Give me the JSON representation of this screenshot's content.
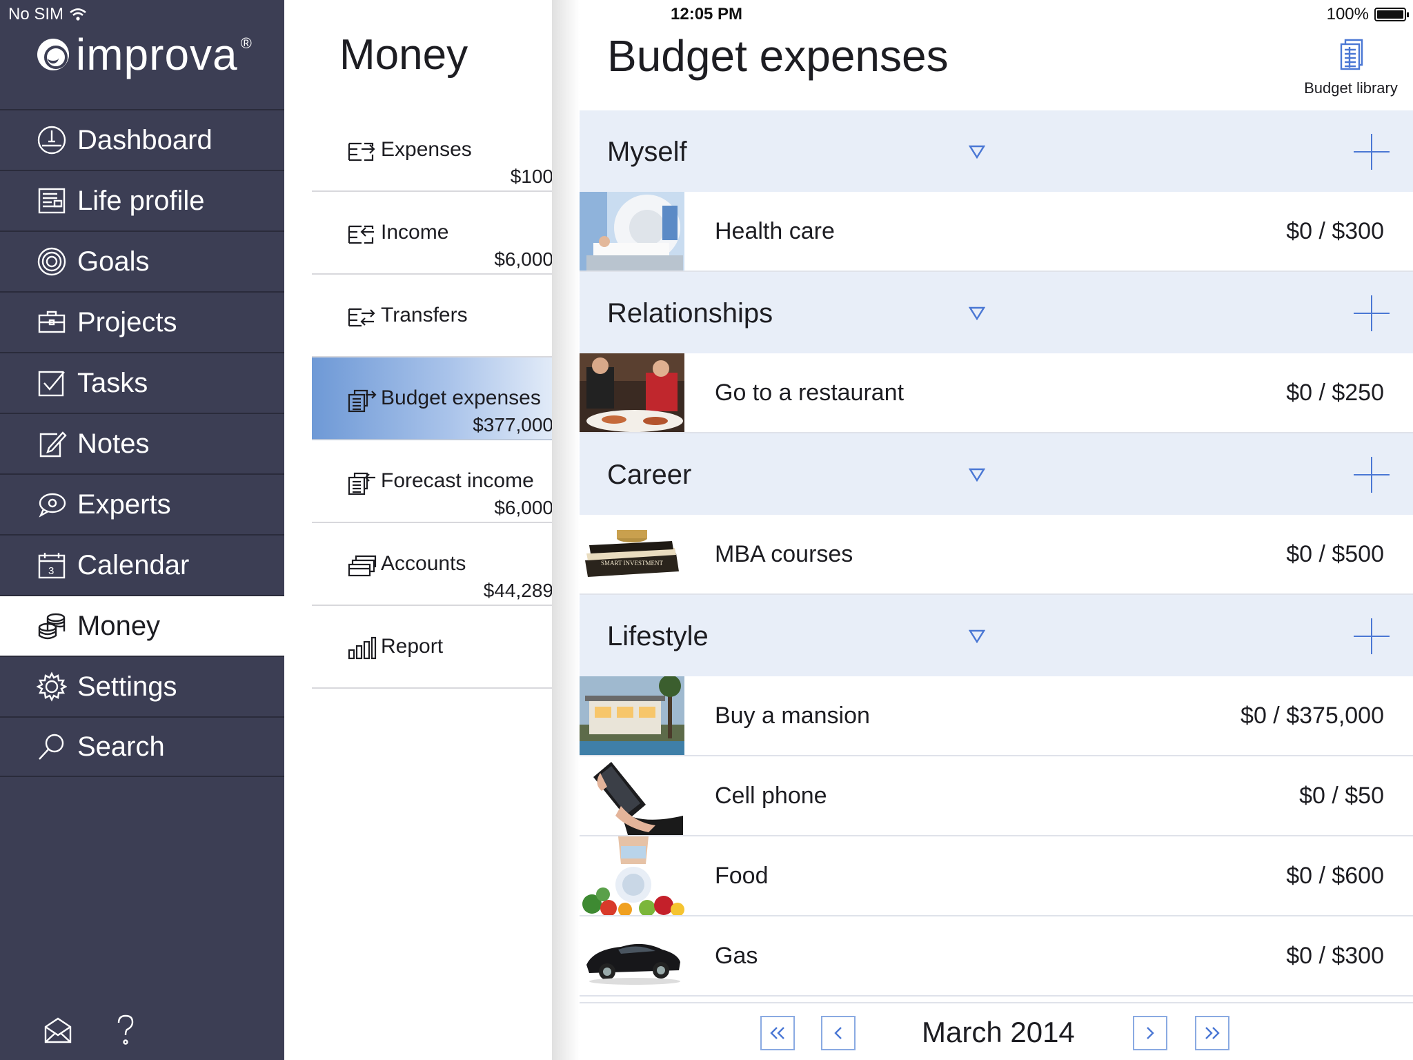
{
  "status": {
    "carrier": "No SIM",
    "time": "12:05 PM",
    "battery": "100%"
  },
  "brand": {
    "name": "improva",
    "reg": "®"
  },
  "nav": [
    {
      "label": "Dashboard",
      "icon": "dashboard-icon"
    },
    {
      "label": "Life profile",
      "icon": "life-profile-icon"
    },
    {
      "label": "Goals",
      "icon": "goals-icon"
    },
    {
      "label": "Projects",
      "icon": "projects-icon"
    },
    {
      "label": "Tasks",
      "icon": "tasks-icon"
    },
    {
      "label": "Notes",
      "icon": "notes-icon"
    },
    {
      "label": "Experts",
      "icon": "experts-icon"
    },
    {
      "label": "Calendar",
      "icon": "calendar-icon",
      "badge": "3"
    },
    {
      "label": "Money",
      "icon": "money-icon",
      "active": true
    },
    {
      "label": "Settings",
      "icon": "settings-icon"
    },
    {
      "label": "Search",
      "icon": "search-icon"
    }
  ],
  "money": {
    "title": "Money",
    "items": [
      {
        "label": "Expenses",
        "value": "$100",
        "icon": "expenses-icon"
      },
      {
        "label": "Income",
        "value": "$6,000",
        "icon": "income-icon"
      },
      {
        "label": "Transfers",
        "value": "",
        "icon": "transfers-icon"
      },
      {
        "label": "Budget expenses",
        "value": "$377,000",
        "icon": "budget-expenses-icon",
        "active": true
      },
      {
        "label": "Forecast income",
        "value": "$6,000",
        "icon": "forecast-income-icon"
      },
      {
        "label": "Accounts",
        "value": "$44,289",
        "icon": "accounts-icon"
      },
      {
        "label": "Report",
        "value": "",
        "icon": "report-icon"
      }
    ]
  },
  "detail": {
    "title": "Budget expenses",
    "library_label": "Budget library",
    "groups": [
      {
        "title": "Myself",
        "rows": [
          {
            "name": "Health care",
            "amount": "$0 / $300",
            "image": "mri-scanner-image"
          }
        ]
      },
      {
        "title": "Relationships",
        "rows": [
          {
            "name": "Go to a restaurant",
            "amount": "$0 / $250",
            "image": "restaurant-image"
          }
        ]
      },
      {
        "title": "Career",
        "rows": [
          {
            "name": "MBA courses",
            "amount": "$0 / $500",
            "image": "books-image",
            "image_text": "SMART INVESTMENT"
          }
        ]
      },
      {
        "title": "Lifestyle",
        "rows": [
          {
            "name": "Buy a mansion",
            "amount": "$0 / $375,000",
            "image": "mansion-image"
          },
          {
            "name": "Cell phone",
            "amount": "$0 / $50",
            "image": "phone-image"
          },
          {
            "name": "Food",
            "amount": "$0 / $600",
            "image": "food-image"
          },
          {
            "name": "Gas",
            "amount": "$0 / $300",
            "image": "car-image"
          }
        ]
      }
    ]
  },
  "pager": {
    "month": "March 2014"
  },
  "colors": {
    "sidebar": "#3c3e54",
    "accent": "#4a77d4",
    "group_bg": "#e8eef8"
  }
}
